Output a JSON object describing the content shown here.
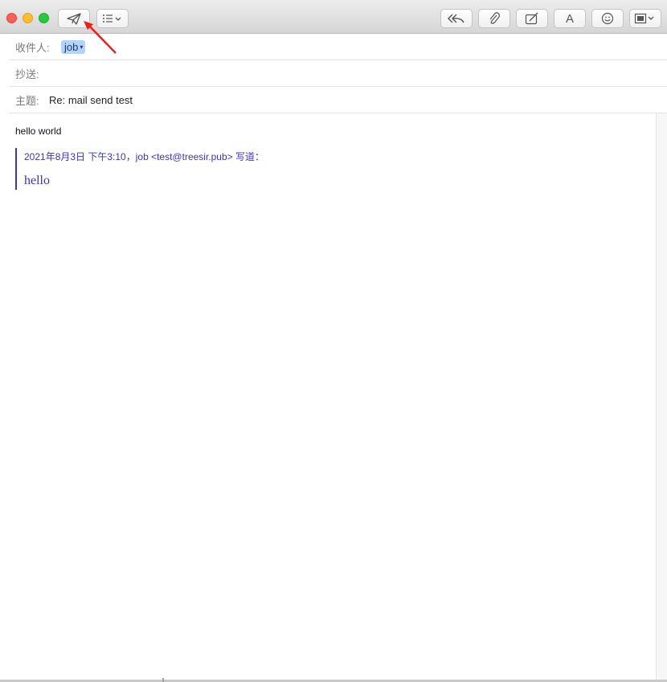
{
  "toolbar": {
    "send_icon": "paper-plane-icon",
    "format_icon": "list-format-icon",
    "reply_all_icon": "reply-all-icon",
    "attach_icon": "paperclip-icon",
    "markup_icon": "markup-icon",
    "font_label": "A",
    "emoji_icon": "smiley-icon",
    "photo_icon": "photo-browser-icon"
  },
  "header": {
    "to_label": "收件人:",
    "to_recipient": "job",
    "cc_label": "抄送:",
    "cc_value": "",
    "subject_label": "主题:",
    "subject_value": "Re: mail send test"
  },
  "message": {
    "body_text": "hello world",
    "quote_header": "2021年8月3日 下午3:10，job <test@treesir.pub> 写道：",
    "quote_body": "hello"
  },
  "colors": {
    "quote": "#3a36b5",
    "chip_bg": "#b5d2fb",
    "annotation_arrow": "#e8201c"
  }
}
